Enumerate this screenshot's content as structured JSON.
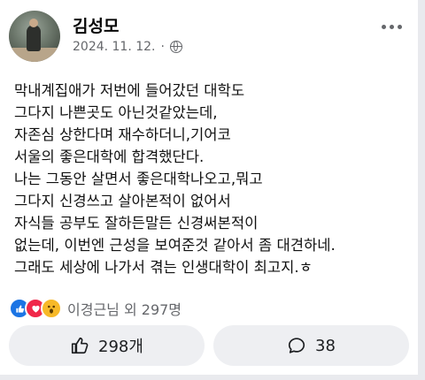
{
  "post": {
    "author": "김성모",
    "date": "2024. 11. 12.",
    "date_separator": "·",
    "privacy_icon": "globe-icon",
    "lines": [
      "막내계집애가 저번에 들어갔던 대학도",
      "그다지 나쁜곳도 아닌것같았는데,",
      "자존심 상한다며 재수하더니,기어코",
      "서울의 좋은대학에 합격했단다.",
      "나는 그동안 살면서 좋은대학나오고,뭐고",
      "그다지 신경쓰고 살아본적이 없어서",
      "자식들 공부도 잘하든말든 신경써본적이",
      "없는데, 이번엔 근성을 보여준것 같아서 좀 대견하네.",
      "그래도 세상에 나가서 겪는 인생대학이 최고지.ㅎ"
    ]
  },
  "reactions": {
    "icons": [
      "like-reaction-icon",
      "love-reaction-icon",
      "wow-reaction-icon"
    ],
    "summary": "이경근님 외 297명"
  },
  "actions": {
    "like_count": "298개",
    "comment_count": "38"
  },
  "colors": {
    "like": "#1b74e4",
    "love": "#f0284a",
    "wow": "#f7b928",
    "meta": "#65676b",
    "pill": "#eeeff2"
  }
}
